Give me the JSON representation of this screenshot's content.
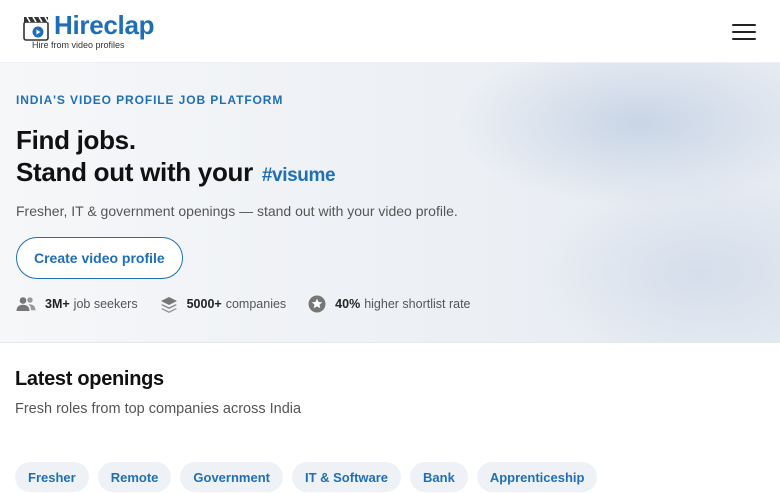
{
  "navbar": {
    "logo_title": "Hireclap",
    "logo_tagline": "Hire from video profiles"
  },
  "hero": {
    "eyebrow": "INDIA'S VIDEO PROFILE JOB PLATFORM",
    "headline_line1": "Find jobs.",
    "headline_line2": "Stand out with your",
    "hashtag": "#visume",
    "subtitle": "Fresher, IT & government openings — stand out with your video profile.",
    "cta_label": "Create video profile",
    "stats": [
      {
        "icon": "users-icon",
        "value": "3M+",
        "label": "job seekers"
      },
      {
        "icon": "layers-icon",
        "value": "5000+",
        "label": "companies"
      },
      {
        "icon": "star-badge-icon",
        "value": "40%",
        "label": "higher shortlist rate"
      }
    ]
  },
  "latest": {
    "title": "Latest openings",
    "subtitle": "Fresh roles from top companies across India",
    "chips": [
      "Fresher",
      "Remote",
      "Government",
      "IT & Software",
      "Bank",
      "Apprenticeship"
    ]
  },
  "colors": {
    "brand_blue": "#1f6fb8",
    "chip_bg": "#eef2f7",
    "text_dark": "#111111",
    "text_muted": "#555555"
  }
}
